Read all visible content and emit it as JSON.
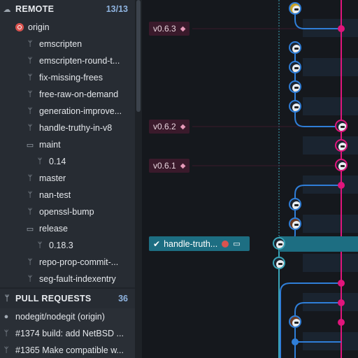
{
  "remote": {
    "title": "REMOTE",
    "count": "13/13",
    "origin": "origin",
    "branches": [
      "emscripten",
      "emscripten-round-t...",
      "fix-missing-frees",
      "free-raw-on-demand",
      "generation-improve...",
      "handle-truthy-in-v8"
    ],
    "maint_folder": "maint",
    "maint_child": "0.14",
    "branches2": [
      "master",
      "nan-test",
      "openssl-bump"
    ],
    "release_folder": "release",
    "release_child": "0.18.3",
    "branches3": [
      "repo-prop-commit-...",
      "seg-fault-indexentry"
    ]
  },
  "pull_requests": {
    "title": "PULL REQUESTS",
    "count": "36",
    "repo": "nodegit/nodegit (origin)",
    "items": [
      "#1374 build: add NetBSD ...",
      "#1365 Make compatible w..."
    ]
  },
  "graph": {
    "tags": [
      "v0.6.3",
      "v0.6.2",
      "v0.6.1"
    ],
    "current_branch": "handle-truth...",
    "colors": {
      "blue": "#2f7ed8",
      "pink": "#e0157c",
      "teal": "#1d6e82",
      "cyan": "#3aa5b8"
    }
  }
}
